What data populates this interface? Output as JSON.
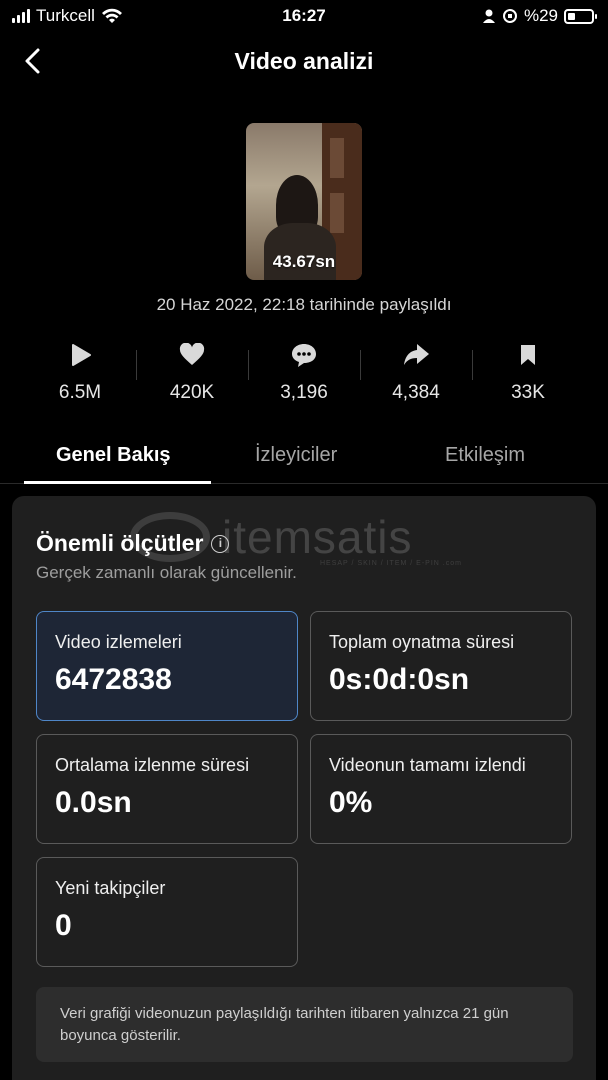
{
  "status_bar": {
    "carrier": "Turkcell",
    "time": "16:27",
    "battery": "%29"
  },
  "header": {
    "title": "Video analizi"
  },
  "video": {
    "duration": "43.67sn",
    "posted_text": "20 Haz 2022, 22:18 tarihinde paylaşıldı"
  },
  "stats": [
    {
      "icon": "play-icon",
      "value": "6.5M"
    },
    {
      "icon": "heart-icon",
      "value": "420K"
    },
    {
      "icon": "comment-icon",
      "value": "3,196"
    },
    {
      "icon": "share-icon",
      "value": "4,384"
    },
    {
      "icon": "bookmark-icon",
      "value": "33K"
    }
  ],
  "tabs": [
    {
      "label": "Genel Bakış",
      "active": true
    },
    {
      "label": "İzleyiciler",
      "active": false
    },
    {
      "label": "Etkileşim",
      "active": false
    }
  ],
  "key_metrics": {
    "title": "Önemli ölçütler",
    "subtitle": "Gerçek zamanlı olarak güncellenir.",
    "items": [
      {
        "label": "Video izlemeleri",
        "value": "6472838",
        "selected": true
      },
      {
        "label": "Toplam oynatma süresi",
        "value": "0s:0d:0sn",
        "selected": false
      },
      {
        "label": "Ortalama izlenme süresi",
        "value": "0.0sn",
        "selected": false
      },
      {
        "label": "Videonun tamamı izlendi",
        "value": "0%",
        "selected": false
      },
      {
        "label": "Yeni takipçiler",
        "value": "0",
        "selected": false
      }
    ],
    "note": "Veri grafiği videonuzun paylaşıldığı tarihten itibaren yalnızca 21 gün boyunca gösterilir."
  },
  "watermark": {
    "text": "itemsatis",
    "tagline": "HESAP / SKIN / ITEM / E-PIN .com"
  },
  "colors": {
    "background": "#000000",
    "card": "#1f1f1f",
    "selected_border": "#4f86c7"
  }
}
